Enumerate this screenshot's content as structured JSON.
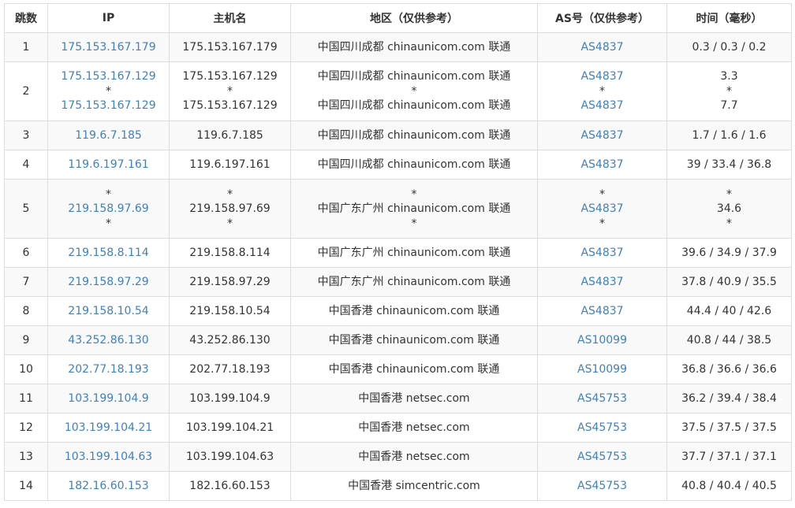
{
  "headers": [
    "跳数",
    "IP",
    "主机名",
    "地区（仅供参考）",
    "AS号（仅供参考）",
    "时间（毫秒）"
  ],
  "rows": [
    {
      "hop": "1",
      "ip": [
        "175.153.167.179"
      ],
      "host": [
        "175.153.167.179"
      ],
      "region": [
        "中国四川成都 chinaunicom.com 联通"
      ],
      "as": [
        "AS4837"
      ],
      "time": [
        "0.3 / 0.3 / 0.2"
      ]
    },
    {
      "hop": "2",
      "ip": [
        "175.153.167.129",
        "*",
        "175.153.167.129"
      ],
      "host": [
        "175.153.167.129",
        "*",
        "175.153.167.129"
      ],
      "region": [
        "中国四川成都 chinaunicom.com 联通",
        "*",
        "中国四川成都 chinaunicom.com 联通"
      ],
      "as": [
        "AS4837",
        "*",
        "AS4837"
      ],
      "time": [
        "3.3",
        "*",
        "7.7"
      ]
    },
    {
      "hop": "3",
      "ip": [
        "119.6.7.185"
      ],
      "host": [
        "119.6.7.185"
      ],
      "region": [
        "中国四川成都 chinaunicom.com 联通"
      ],
      "as": [
        "AS4837"
      ],
      "time": [
        "1.7 / 1.6 / 1.6"
      ]
    },
    {
      "hop": "4",
      "ip": [
        "119.6.197.161"
      ],
      "host": [
        "119.6.197.161"
      ],
      "region": [
        "中国四川成都 chinaunicom.com 联通"
      ],
      "as": [
        "AS4837"
      ],
      "time": [
        "39 / 33.4 / 36.8"
      ]
    },
    {
      "hop": "5",
      "ip": [
        "*",
        "219.158.97.69",
        "*"
      ],
      "host": [
        "*",
        "219.158.97.69",
        "*"
      ],
      "region": [
        "*",
        "中国广东广州 chinaunicom.com 联通",
        "*"
      ],
      "as": [
        "*",
        "AS4837",
        "*"
      ],
      "time": [
        "*",
        "34.6",
        "*"
      ]
    },
    {
      "hop": "6",
      "ip": [
        "219.158.8.114"
      ],
      "host": [
        "219.158.8.114"
      ],
      "region": [
        "中国广东广州 chinaunicom.com 联通"
      ],
      "as": [
        "AS4837"
      ],
      "time": [
        "39.6 / 34.9 / 37.9"
      ]
    },
    {
      "hop": "7",
      "ip": [
        "219.158.97.29"
      ],
      "host": [
        "219.158.97.29"
      ],
      "region": [
        "中国广东广州 chinaunicom.com 联通"
      ],
      "as": [
        "AS4837"
      ],
      "time": [
        "37.8 / 40.9 / 35.5"
      ]
    },
    {
      "hop": "8",
      "ip": [
        "219.158.10.54"
      ],
      "host": [
        "219.158.10.54"
      ],
      "region": [
        "中国香港 chinaunicom.com 联通"
      ],
      "as": [
        "AS4837"
      ],
      "time": [
        "44.4 / 40 / 42.6"
      ]
    },
    {
      "hop": "9",
      "ip": [
        "43.252.86.130"
      ],
      "host": [
        "43.252.86.130"
      ],
      "region": [
        "中国香港 chinaunicom.com 联通"
      ],
      "as": [
        "AS10099"
      ],
      "time": [
        "40.8 / 44 / 38.5"
      ]
    },
    {
      "hop": "10",
      "ip": [
        "202.77.18.193"
      ],
      "host": [
        "202.77.18.193"
      ],
      "region": [
        "中国香港 chinaunicom.com 联通"
      ],
      "as": [
        "AS10099"
      ],
      "time": [
        "36.8 / 36.6 / 36.6"
      ]
    },
    {
      "hop": "11",
      "ip": [
        "103.199.104.9"
      ],
      "host": [
        "103.199.104.9"
      ],
      "region": [
        "中国香港 netsec.com"
      ],
      "as": [
        "AS45753"
      ],
      "time": [
        "36.2 / 39.4 / 38.4"
      ]
    },
    {
      "hop": "12",
      "ip": [
        "103.199.104.21"
      ],
      "host": [
        "103.199.104.21"
      ],
      "region": [
        "中国香港 netsec.com"
      ],
      "as": [
        "AS45753"
      ],
      "time": [
        "37.5 / 37.5 / 37.5"
      ]
    },
    {
      "hop": "13",
      "ip": [
        "103.199.104.63"
      ],
      "host": [
        "103.199.104.63"
      ],
      "region": [
        "中国香港 netsec.com"
      ],
      "as": [
        "AS45753"
      ],
      "time": [
        "37.7 / 37.1 / 37.1"
      ]
    },
    {
      "hop": "14",
      "ip": [
        "182.16.60.153"
      ],
      "host": [
        "182.16.60.153"
      ],
      "region": [
        "中国香港 simcentric.com"
      ],
      "as": [
        "AS45753"
      ],
      "time": [
        "40.8 / 40.4 / 40.5"
      ]
    }
  ],
  "colors": {
    "link": "#3f80c0",
    "text": "#333333",
    "border": "#dddddd",
    "stripe": "#f9f9f9"
  }
}
